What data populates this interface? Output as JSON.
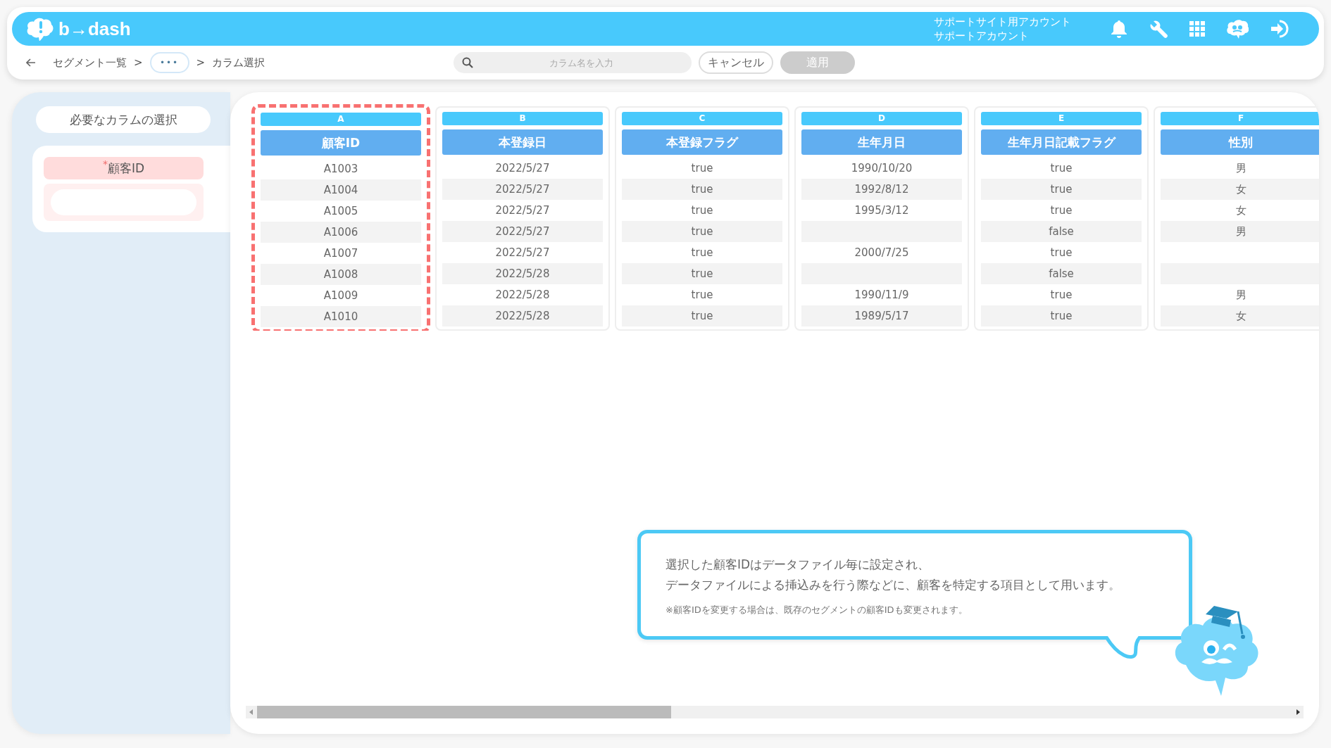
{
  "header": {
    "logo": "b→dash",
    "account_lines": [
      "サポートサイト用アカウント",
      "サポートアカウント"
    ]
  },
  "breadcrumb": {
    "items": [
      "セグメント一覧",
      "カラム選択"
    ],
    "separator": ">",
    "ellipsis": "•••"
  },
  "search": {
    "placeholder": "カラム名を入力"
  },
  "buttons": [
    {
      "label": "キャンセル",
      "disabled": false
    },
    {
      "label": "適用",
      "disabled": true
    }
  ],
  "sidebar": {
    "title": "必要なカラムの選択",
    "fields": [
      {
        "label": "顧客ID",
        "required_mark": "*"
      }
    ]
  },
  "columns": [
    {
      "letter": "A",
      "name": "顧客ID",
      "selected": true,
      "cells": [
        "A1003",
        "A1004",
        "A1005",
        "A1006",
        "A1007",
        "A1008",
        "A1009",
        "A1010"
      ]
    },
    {
      "letter": "B",
      "name": "本登録日",
      "selected": false,
      "cells": [
        "2022/5/27",
        "2022/5/27",
        "2022/5/27",
        "2022/5/27",
        "2022/5/27",
        "2022/5/28",
        "2022/5/28",
        "2022/5/28"
      ]
    },
    {
      "letter": "C",
      "name": "本登録フラグ",
      "selected": false,
      "cells": [
        "true",
        "true",
        "true",
        "true",
        "true",
        "true",
        "true",
        "true"
      ]
    },
    {
      "letter": "D",
      "name": "生年月日",
      "selected": false,
      "cells": [
        "1990/10/20",
        "1992/8/12",
        "1995/3/12",
        null,
        "2000/7/25",
        null,
        "1990/11/9",
        "1989/5/17"
      ]
    },
    {
      "letter": "E",
      "name": "生年月日記載フラグ",
      "selected": false,
      "cells": [
        "true",
        "true",
        "true",
        "false",
        "true",
        "false",
        "true",
        "true"
      ]
    },
    {
      "letter": "F",
      "name": "性別",
      "selected": false,
      "cells": [
        "男",
        "女",
        "女",
        "男",
        null,
        null,
        "男",
        "女"
      ]
    }
  ],
  "notice": {
    "lines": [
      "選択した顧客IDはデータファイル毎に設定され、",
      "データファイルによる挿込みを行う際などに、顧客を特定する項目として用います。"
    ],
    "note": "※顧客IDを変更する場合は、既存のセグメントの顧客IDも変更されます。"
  }
}
